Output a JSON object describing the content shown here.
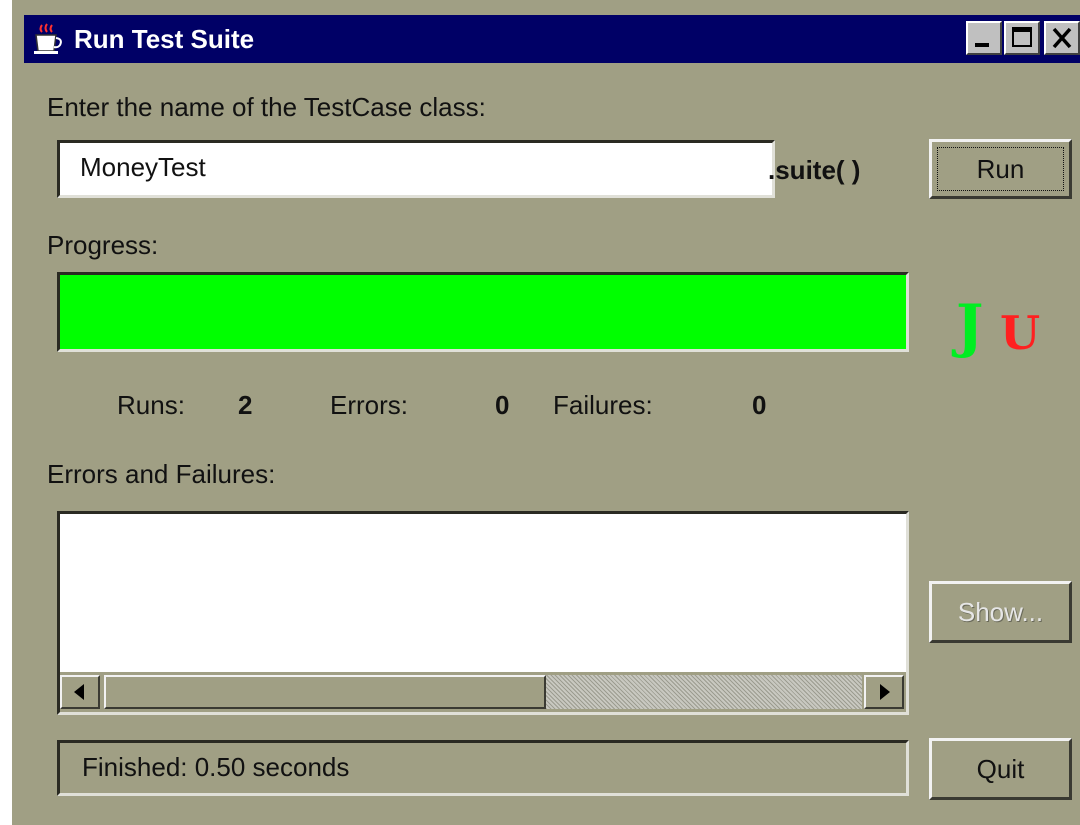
{
  "window": {
    "title": "Run Test Suite",
    "controls": [
      "minimize-icon",
      "maximize-icon",
      "close-icon"
    ]
  },
  "form": {
    "prompt": "Enter the name of the TestCase class:",
    "testcase_value": "MoneyTest",
    "suffix": ".suite( )",
    "run_label": "Run"
  },
  "progress": {
    "label": "Progress:",
    "fraction": 1.0,
    "color": "#00ff00"
  },
  "logo": {
    "letter_j": "J",
    "letter_u": "U",
    "color_j": "#00ee22",
    "color_u": "#ff2020"
  },
  "stats": {
    "runs_label": "Runs:",
    "runs": "2",
    "errors_label": "Errors:",
    "errors": "0",
    "failures_label": "Failures:",
    "failures": "0"
  },
  "failures_panel": {
    "label": "Errors and Failures:",
    "show_label": "Show..."
  },
  "status": {
    "text": "Finished: 0.50 seconds",
    "quit_label": "Quit"
  }
}
